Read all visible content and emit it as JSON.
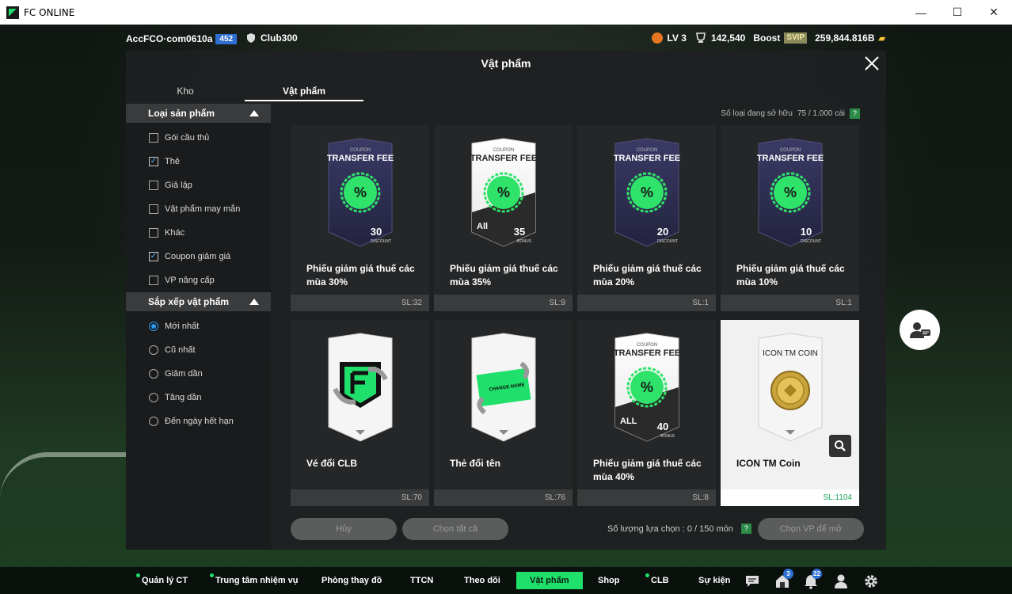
{
  "window": {
    "title": "FC ONLINE",
    "minimize": "—",
    "maximize": "☐",
    "close": "✕"
  },
  "topbar": {
    "account": "AccFCO·com0610a",
    "account_badge": "452",
    "club": "Club300",
    "level": "LV 3",
    "trophy_value": "142,540",
    "boost_label": "Boost",
    "svip_label": "SVIP",
    "currency": "259,844.816B"
  },
  "panel": {
    "title": "Vật phẩm",
    "tabs": [
      "Kho",
      "Vật phẩm"
    ],
    "owned_label": "Số loại đang sở hữu",
    "owned_value": "75 / 1.000 cái",
    "help": "?"
  },
  "filters": {
    "product_type_title": "Loại sản phẩm",
    "product_types": [
      {
        "label": "Gói cầu thủ",
        "checked": false
      },
      {
        "label": "Thẻ",
        "checked": true
      },
      {
        "label": "Giả lập",
        "checked": false
      },
      {
        "label": "Vật phẩm may mắn",
        "checked": false
      },
      {
        "label": "Khác",
        "checked": false
      },
      {
        "label": "Coupon giảm giá",
        "checked": true
      },
      {
        "label": "VP nâng cấp",
        "checked": false
      }
    ],
    "sort_title": "Sắp xếp vật phẩm",
    "sort_options": [
      {
        "label": "Mới nhất",
        "checked": true
      },
      {
        "label": "Cũ nhất",
        "checked": false
      },
      {
        "label": "Giảm dần",
        "checked": false
      },
      {
        "label": "Tăng dần",
        "checked": false
      },
      {
        "label": "Đến ngày hết hạn",
        "checked": false
      }
    ]
  },
  "items": [
    {
      "name": "Phiếu giảm giá thuế các mùa 30%",
      "qty": "SL:32",
      "kind": "coupon-dark",
      "percent": "30",
      "coupon_label": "COUPON",
      "coupon_title": "TRANSFER FEE",
      "discount_word": "DISCOUNT"
    },
    {
      "name": "Phiếu giảm giá thuế các mùa 35%",
      "qty": "SL:9",
      "kind": "coupon-light",
      "percent": "35",
      "coupon_label": "COUPON",
      "coupon_title": "TRANSFER FEE",
      "discount_word": "BONUS",
      "all_label": "All"
    },
    {
      "name": "Phiếu giảm giá thuế các mùa 20%",
      "qty": "SL:1",
      "kind": "coupon-dark",
      "percent": "20",
      "coupon_label": "COUPON",
      "coupon_title": "TRANSFER FEE",
      "discount_word": "DISCOUNT"
    },
    {
      "name": "Phiếu giảm giá thuế các mùa 10%",
      "qty": "SL:1",
      "kind": "coupon-dark",
      "percent": "10",
      "coupon_label": "COUPON",
      "coupon_title": "TRANSFER FEE",
      "discount_word": "DISCOUNT"
    },
    {
      "name": "Vé đổi CLB",
      "qty": "SL:70",
      "kind": "club-ticket"
    },
    {
      "name": "Thẻ đổi tên",
      "qty": "SL:76",
      "kind": "name-change",
      "card_text": "CHANGE NAME"
    },
    {
      "name": "Phiếu giảm giá thuế các mùa 40%",
      "qty": "SL:8",
      "kind": "coupon-light",
      "percent": "40",
      "coupon_label": "COUPON",
      "coupon_title": "TRANSFER FEE",
      "discount_word": "BONUS",
      "all_label": "ALL"
    },
    {
      "name": "ICON TM Coin",
      "qty": "SL:1104",
      "kind": "icon-coin",
      "card_text": "ICON TM COIN",
      "selected": true
    }
  ],
  "bottom": {
    "cancel": "Hủy",
    "select_all": "Chọn tất cả",
    "selected_count": "Số lượng lựa chọn : 0 / 150 món",
    "choose_btn": "Chọn VP để mở"
  },
  "nav": {
    "items": [
      "Quản lý CT",
      "Trung tâm nhiệm vụ",
      "Phòng thay đồ",
      "TTCN",
      "Theo dõi",
      "Vật phẩm",
      "Shop",
      "CLB",
      "Sự kiện"
    ],
    "mail_badge": "3",
    "bell_badge": "22"
  },
  "colors": {
    "accent": "#1fe06b",
    "coupon_green": "#2fe36a",
    "selected_qty": "#1ca85a"
  }
}
